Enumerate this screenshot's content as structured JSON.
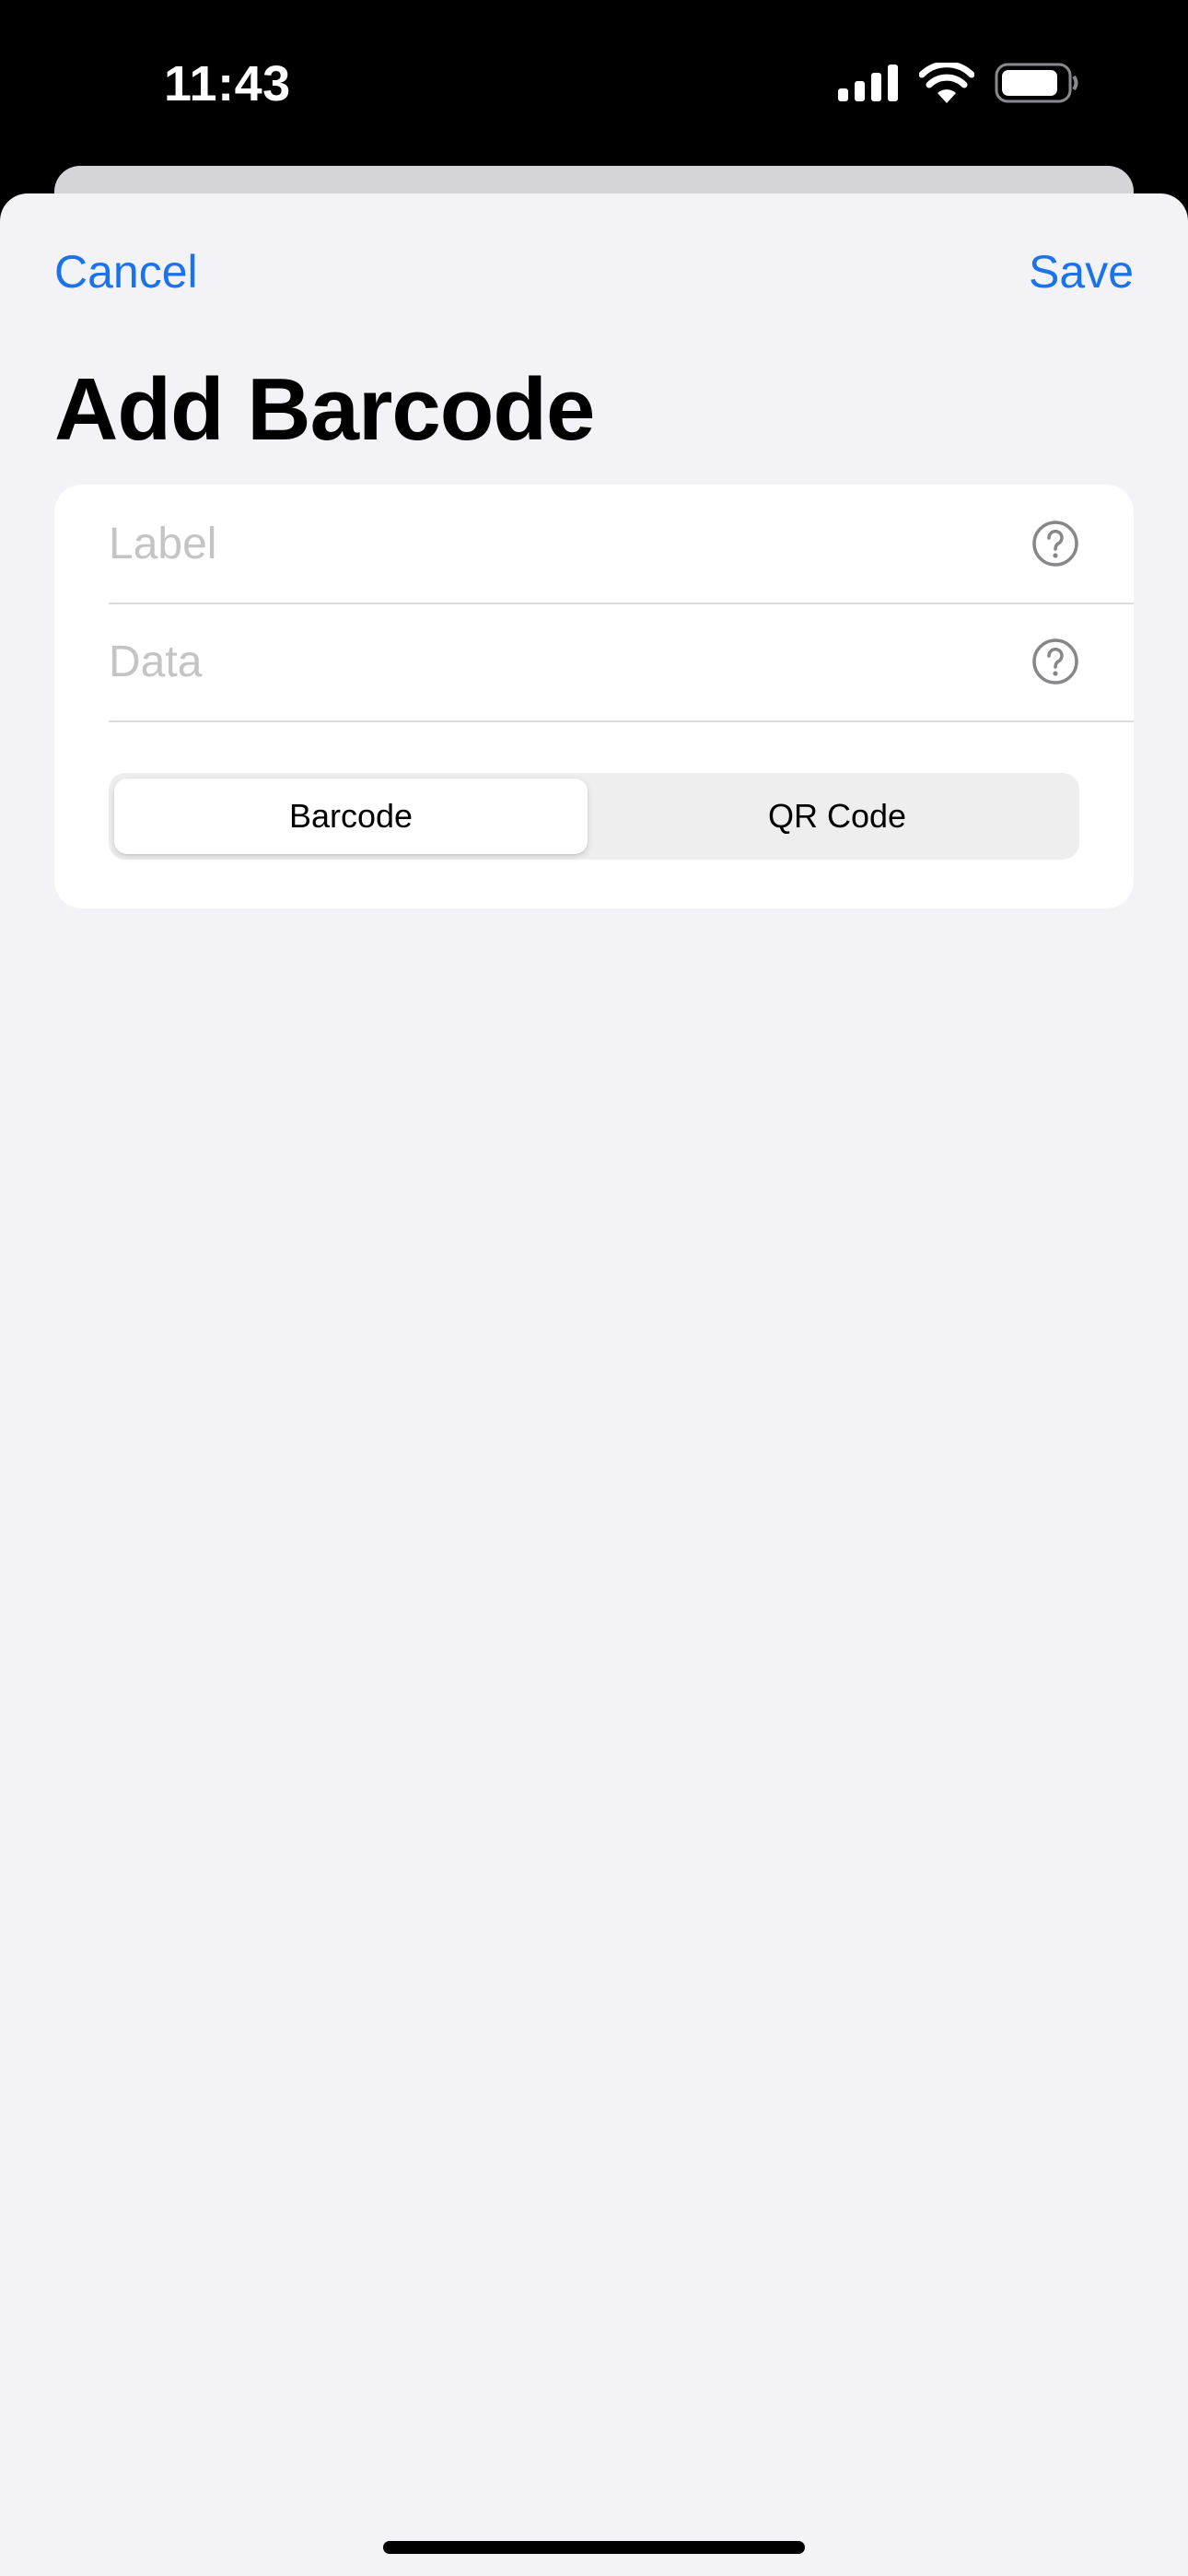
{
  "status_bar": {
    "time": "11:43",
    "icons": [
      "cellular-signal-icon",
      "wifi-icon",
      "battery-icon"
    ]
  },
  "nav": {
    "cancel_label": "Cancel",
    "save_label": "Save"
  },
  "page": {
    "title": "Add Barcode"
  },
  "form": {
    "label_field": {
      "placeholder": "Label",
      "value": ""
    },
    "data_field": {
      "placeholder": "Data",
      "value": ""
    },
    "type_selector": {
      "options": [
        "Barcode",
        "QR Code"
      ],
      "selected": "Barcode"
    }
  },
  "colors": {
    "accent": "#1a73e8",
    "sheet_background": "#f2f2f7",
    "card_background": "#ffffff",
    "placeholder": "#c4c4c7"
  }
}
